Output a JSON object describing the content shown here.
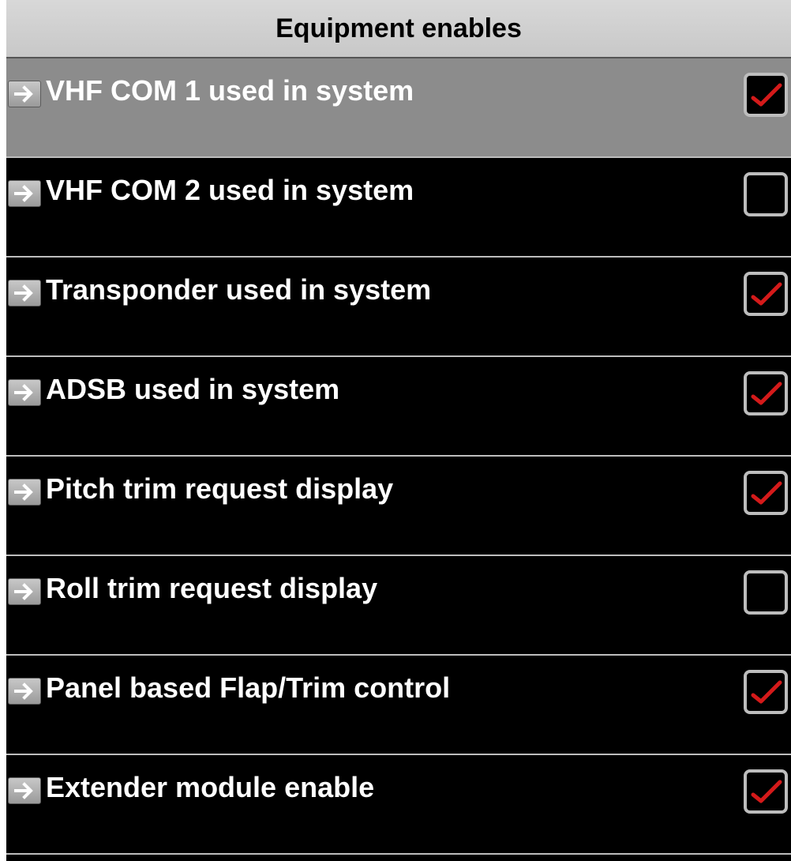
{
  "header": {
    "title": "Equipment enables"
  },
  "items": [
    {
      "label": "VHF COM 1 used in system",
      "checked": true,
      "selected": true
    },
    {
      "label": "VHF COM 2 used in system",
      "checked": false,
      "selected": false
    },
    {
      "label": "Transponder used in system",
      "checked": true,
      "selected": false
    },
    {
      "label": "ADSB used in system",
      "checked": true,
      "selected": false
    },
    {
      "label": "Pitch trim request display",
      "checked": true,
      "selected": false
    },
    {
      "label": "Roll trim request display",
      "checked": false,
      "selected": false
    },
    {
      "label": "Panel based Flap/Trim control",
      "checked": true,
      "selected": false
    },
    {
      "label": "Extender module enable",
      "checked": true,
      "selected": false
    }
  ],
  "icons": {
    "row_arrow": "arrow-right-icon",
    "check": "checkmark-icon"
  },
  "colors": {
    "check_mark": "#d41a1a",
    "selected_row": "#8c8c8c",
    "background": "#000000"
  }
}
